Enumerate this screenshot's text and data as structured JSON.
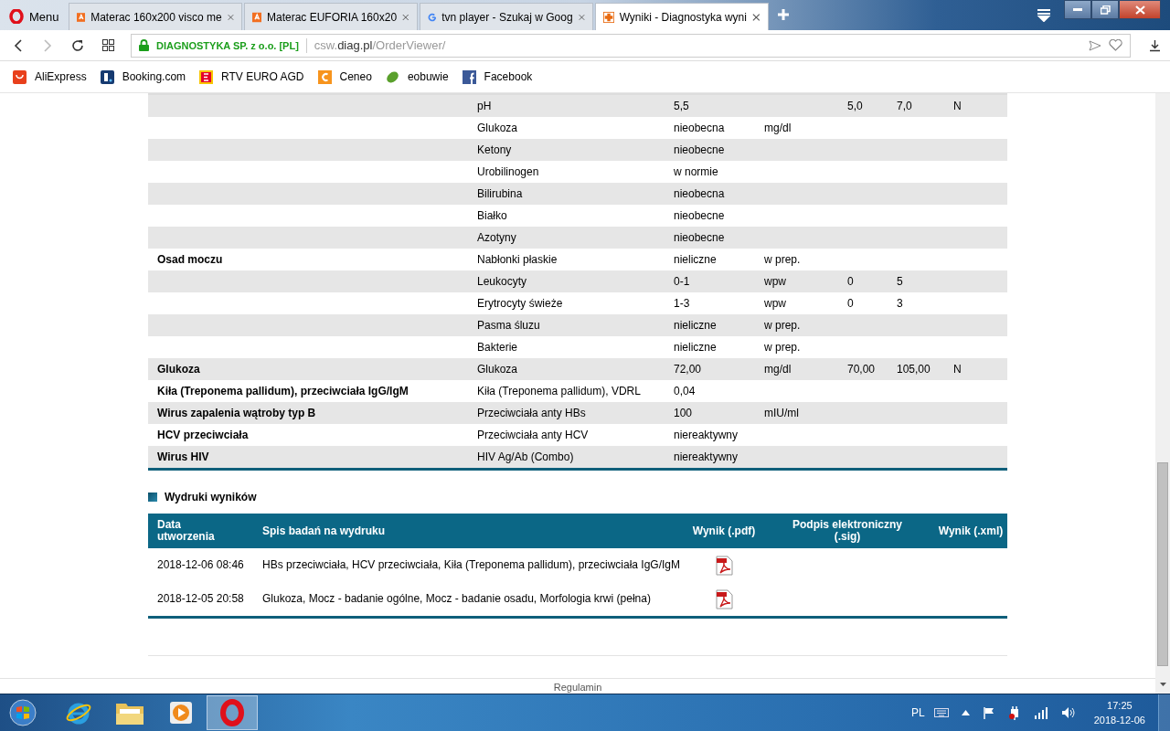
{
  "browser": {
    "menu_label": "Menu",
    "tabs": [
      {
        "title": "Materac 160x200 visco me",
        "selected": false
      },
      {
        "title": "Materac EUFORIA 160x20",
        "selected": false
      },
      {
        "title": "tvn player - Szukaj w Goog",
        "selected": false
      },
      {
        "title": "Wyniki - Diagnostyka wyni",
        "selected": true
      }
    ],
    "site_identity": "DIAGNOSTYKA SP. z o.o. [PL]",
    "url": {
      "prefix": "csw.",
      "domain": "diag.pl",
      "path": "/OrderViewer/"
    },
    "bookmarks": [
      {
        "label": "AliExpress"
      },
      {
        "label": "Booking.com"
      },
      {
        "label": "RTV EURO AGD"
      },
      {
        "label": "Ceneo"
      },
      {
        "label": "eobuwie"
      },
      {
        "label": "Facebook"
      }
    ]
  },
  "results": {
    "rows": [
      {
        "name": "pH",
        "value": "5,5",
        "min": "5,0",
        "max": "7,0",
        "flag": "N"
      },
      {
        "name": "Glukoza",
        "value": "nieobecna",
        "unit": "mg/dl"
      },
      {
        "name": "Ketony",
        "value": "nieobecne"
      },
      {
        "name": "Urobilinogen",
        "value": "w normie"
      },
      {
        "name": "Bilirubina",
        "value": "nieobecna"
      },
      {
        "name": "Białko",
        "value": "nieobecne"
      },
      {
        "name": "Azotyny",
        "value": "nieobecne"
      },
      {
        "group": "Osad moczu",
        "name": "Nabłonki płaskie",
        "value": "nieliczne",
        "unit": "w prep."
      },
      {
        "name": "Leukocyty",
        "value": "0-1",
        "unit": "wpw",
        "min": "0",
        "max": "5"
      },
      {
        "name": "Erytrocyty świeże",
        "value": "1-3",
        "unit": "wpw",
        "min": "0",
        "max": "3"
      },
      {
        "name": "Pasma śluzu",
        "value": "nieliczne",
        "unit": "w prep."
      },
      {
        "name": "Bakterie",
        "value": "nieliczne",
        "unit": "w prep."
      },
      {
        "group": "Glukoza",
        "name": "Glukoza",
        "value": "72,00",
        "unit": "mg/dl",
        "min": "70,00",
        "max": "105,00",
        "flag": "N"
      },
      {
        "group": "Kiła (Treponema pallidum), przeciwciała IgG/IgM",
        "name": "Kiła (Treponema pallidum), VDRL",
        "value": "0,04"
      },
      {
        "group": "Wirus zapalenia wątroby typ B",
        "name": "Przeciwciała anty HBs",
        "value": "100",
        "unit": "mIU/ml"
      },
      {
        "group": "HCV przeciwciała",
        "name": "Przeciwciała anty HCV",
        "value": "niereaktywny"
      },
      {
        "group": "Wirus HIV",
        "name": "HIV Ag/Ab (Combo)",
        "value": "niereaktywny"
      }
    ]
  },
  "printouts": {
    "heading": "Wydruki wyników",
    "columns": [
      "Data utworzenia",
      "Spis badań na wydruku",
      "Wynik (.pdf)",
      "Podpis elektroniczny (.sig)",
      "Wynik (.xml)"
    ],
    "rows": [
      {
        "date": "2018-12-06 08:46",
        "tests": "HBs przeciwciała, HCV przeciwciała, Kiła (Treponema pallidum), przeciwciała IgG/IgM"
      },
      {
        "date": "2018-12-05 20:58",
        "tests": "Glukoza, Mocz - badanie ogólne, Mocz - badanie osadu, Morfologia krwi (pełna)"
      }
    ]
  },
  "footer_link": "Regulamin",
  "taskbar": {
    "apps": [
      {
        "selected": false
      },
      {
        "selected": false
      },
      {
        "selected": false
      },
      {
        "selected": true
      }
    ],
    "language": "PL",
    "time": "17:25",
    "date": "2018-12-06"
  }
}
